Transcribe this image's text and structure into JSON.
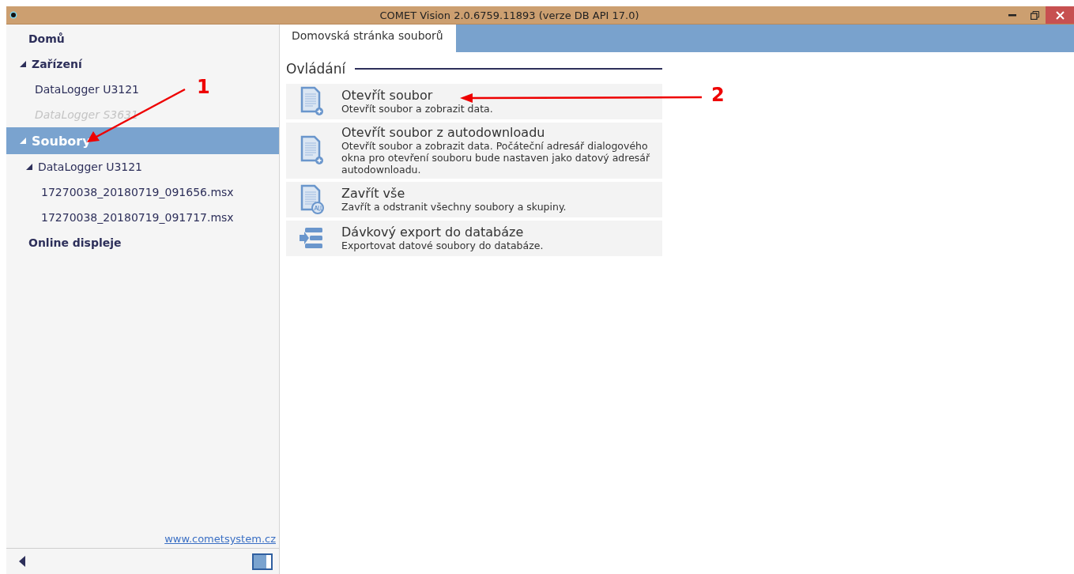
{
  "window": {
    "title": "COMET Vision 2.0.6759.11893 (verze DB API 17.0)"
  },
  "sidebar": {
    "tree": [
      {
        "label": "Domů",
        "selected": false,
        "disabled": false
      },
      {
        "label": "Zařízení",
        "selected": false,
        "disabled": false,
        "expanded": true,
        "children": [
          {
            "label": "DataLogger U3121",
            "selected": false,
            "disabled": false
          },
          {
            "label": "DataLogger S3631",
            "selected": false,
            "disabled": true
          }
        ]
      },
      {
        "label": "Soubory",
        "selected": true,
        "disabled": false,
        "expanded": true,
        "children": [
          {
            "label": "DataLogger U3121",
            "selected": false,
            "disabled": false,
            "expanded": true,
            "children": [
              {
                "label": "17270038_20180719_091656.msx",
                "selected": false,
                "disabled": false
              },
              {
                "label": "17270038_20180719_091717.msx",
                "selected": false,
                "disabled": false
              }
            ]
          }
        ]
      },
      {
        "label": "Online displeje",
        "selected": false,
        "disabled": false
      }
    ],
    "link": "www.cometsystem.cz"
  },
  "tabs": [
    {
      "label": "Domovská stránka souborů",
      "selected": true
    }
  ],
  "section": {
    "title": "Ovládání",
    "actions": [
      {
        "kind": "open",
        "title": "Otevřít soubor",
        "description": "Otevřít soubor a zobrazit data."
      },
      {
        "kind": "open",
        "title": "Otevřít soubor z autodownloadu",
        "description": "Otevřít soubor a zobrazit data. Počáteční adresář dialogového okna pro otevření souboru bude nastaven jako datový adresář autodownloadu."
      },
      {
        "kind": "close_all",
        "title": "Zavřít vše",
        "description": "Zavřít a odstranit všechny soubory a skupiny."
      },
      {
        "kind": "export",
        "title": "Dávkový export do databáze",
        "description": "Exportovat datové soubory do databáze."
      }
    ]
  },
  "annotations": [
    {
      "label": "1"
    },
    {
      "label": "2"
    }
  ]
}
